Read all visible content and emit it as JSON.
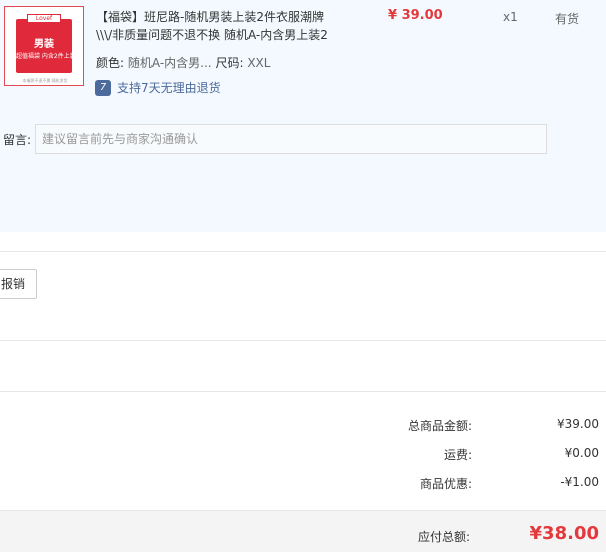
{
  "item": {
    "thumbnail": {
      "tag": "Lovef",
      "title": "男装",
      "subtitle": "超值福袋 内含2件上装",
      "footer": "本福袋不退不换 随机发货",
      "colors": {
        "bag": "#e02a3b",
        "border": "#e34a54"
      }
    },
    "title": "【福袋】班尼路-随机男装上装2件衣服潮牌\\\\\\/非质量问题不退不换 随机A-内含男上装2",
    "price": "¥ 39.00",
    "quantity": "x1",
    "stock_status": "有货",
    "color_label": "颜色:",
    "color_value": "随机A-内含男...",
    "size_label": "尺码:",
    "size_value": "XXL",
    "return_icon": "7",
    "return_policy": "支持7天无理由退货"
  },
  "note": {
    "label": "留言:",
    "placeholder": "建议留言前先与商家沟通确认"
  },
  "invoice": {
    "button_label": "报销"
  },
  "summary": {
    "goods_total_label": "总商品金额:",
    "goods_total_value": "¥39.00",
    "shipping_label": "运费:",
    "shipping_value": "¥0.00",
    "discount_label": "商品优惠:",
    "discount_value": "-¥1.00",
    "payable_label": "应付总额:",
    "payable_value": "¥38.00"
  },
  "colors": {
    "accent_red": "#e4393c",
    "link_blue": "#4d6a9c",
    "panel_bg": "#f3f9fe"
  }
}
